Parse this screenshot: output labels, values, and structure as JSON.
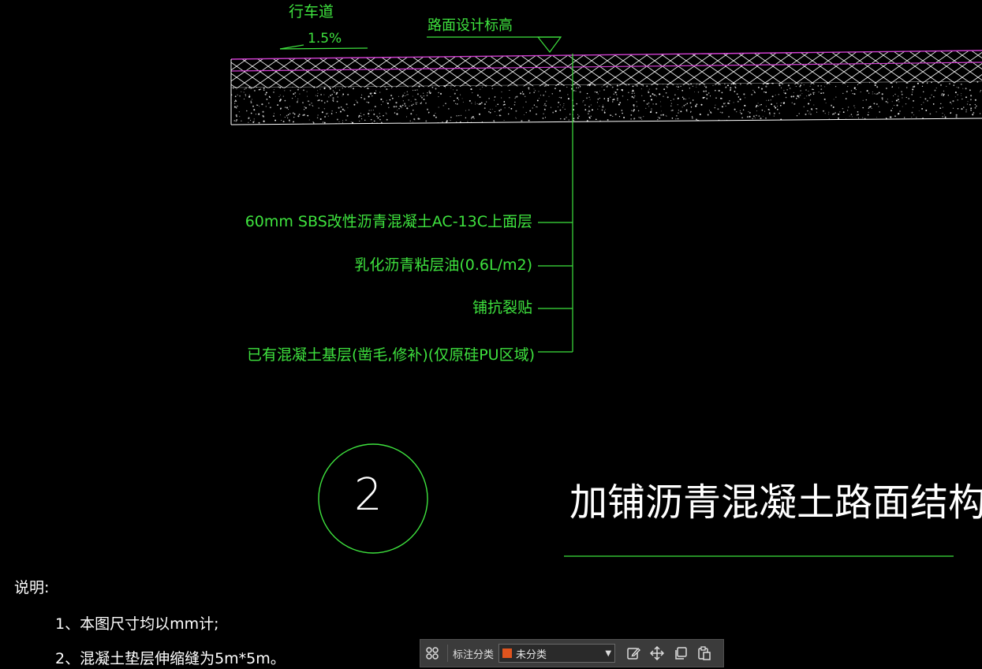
{
  "drawing": {
    "lane_label": "行车道",
    "slope_label": "1.5%",
    "design_elevation_label": "路面设计标高",
    "layers": [
      "60mm SBS改性沥青混凝土AC-13C上面层",
      "乳化沥青粘层油(0.6L/m2)",
      "铺抗裂贴",
      "已有混凝土基层(凿毛,修补)(仅原硅PU区域)"
    ],
    "detail_number": "2",
    "title": "加铺沥青混凝土路面结构图"
  },
  "notes": {
    "heading": "说明:",
    "items": [
      "1、本图尺寸均以mm计;",
      "2、混凝土垫层伸缩缝为5m*5m。"
    ]
  },
  "toolbar": {
    "category_label": "标注分类",
    "category_value": "未分类",
    "category_color": "#e0541e",
    "icons": [
      "grid-icon",
      "edit-icon",
      "move-icon",
      "copy-icon",
      "paste-icon"
    ]
  },
  "colors": {
    "background": "#000000",
    "green": "#3ee23e",
    "magenta": "#d23fd2",
    "white": "#ffffff"
  }
}
